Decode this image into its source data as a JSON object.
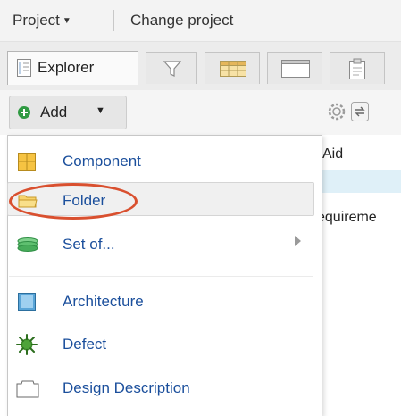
{
  "topbar": {
    "project_label": "Project",
    "change_project_label": "Change project"
  },
  "tabs": [
    {
      "label": "Explorer",
      "icon": "explorer-icon",
      "active": true
    },
    {
      "label": "",
      "icon": "filter-icon"
    },
    {
      "label": "",
      "icon": "grid-icon"
    },
    {
      "label": "",
      "icon": "window-icon"
    },
    {
      "label": "",
      "icon": "clipboard-icon"
    }
  ],
  "toolbar": {
    "add_label": "Add",
    "settings_icon": "gear-icon",
    "sync_icon": "sync-icon"
  },
  "content": {
    "column_header": "Aid",
    "row_text": "equireme"
  },
  "menu": {
    "items": [
      {
        "label": "Component",
        "icon": "component-icon"
      },
      {
        "label": "Folder",
        "icon": "folder-icon",
        "highlighted": true
      },
      {
        "label": "Set of...",
        "icon": "set-icon",
        "has_submenu": true
      },
      {
        "label": "Architecture",
        "icon": "architecture-icon"
      },
      {
        "label": "Defect",
        "icon": "defect-icon"
      },
      {
        "label": "Design Description",
        "icon": "design-description-icon"
      }
    ]
  },
  "colors": {
    "link_blue": "#1b4f9c",
    "add_green": "#2f9a42",
    "annotation_red": "#d9502f"
  }
}
